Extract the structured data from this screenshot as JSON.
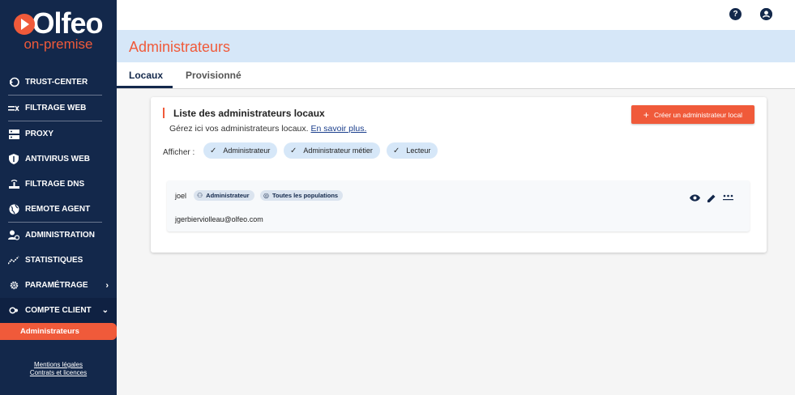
{
  "brand": {
    "logo_text": "Olfeo",
    "logo_sub": "on-premise"
  },
  "sidebar": {
    "items": [
      {
        "label": "TRUST-CENTER",
        "icon": "trust-center-icon"
      },
      {
        "label": "FILTRAGE WEB",
        "icon": "filter-web-icon"
      },
      {
        "label": "PROXY",
        "icon": "proxy-icon"
      },
      {
        "label": "ANTIVIRUS WEB",
        "icon": "shield-icon"
      },
      {
        "label": "FILTRAGE DNS",
        "icon": "dns-icon"
      },
      {
        "label": "REMOTE AGENT",
        "icon": "globe-icon"
      },
      {
        "label": "ADMINISTRATION",
        "icon": "admin-icon"
      },
      {
        "label": "STATISTIQUES",
        "icon": "stats-icon"
      },
      {
        "label": "PARAMÉTRAGE",
        "icon": "gear-icon"
      },
      {
        "label": "COMPTE CLIENT",
        "icon": "account-icon"
      }
    ],
    "active_sub_item": "Administrateurs",
    "footer": {
      "legal": "Mentions légales",
      "contracts": "Contrats et licences"
    }
  },
  "topbar": {
    "help_icon": "help-icon",
    "user_icon": "user-icon"
  },
  "page": {
    "title": "Administrateurs",
    "tabs": [
      {
        "label": "Locaux",
        "active": true
      },
      {
        "label": "Provisionné",
        "active": false
      }
    ]
  },
  "card": {
    "title": "Liste des administrateurs locaux",
    "description": "Gérez ici vos administrateurs locaux.",
    "learn_more": "En savoir plus.",
    "create_button": "Créer un administrateur local",
    "filter_label": "Afficher :",
    "filters": [
      "Administrateur",
      "Administrateur métier",
      "Lecteur"
    ]
  },
  "admins": [
    {
      "name": "joel",
      "role": "Administrateur",
      "population": "Toutes les populations",
      "email": "jgerbierviolleau@olfeo.com"
    }
  ],
  "colors": {
    "accent": "#f05a3a",
    "sidebar": "#13284b",
    "title_bar": "#d6e7f8"
  }
}
